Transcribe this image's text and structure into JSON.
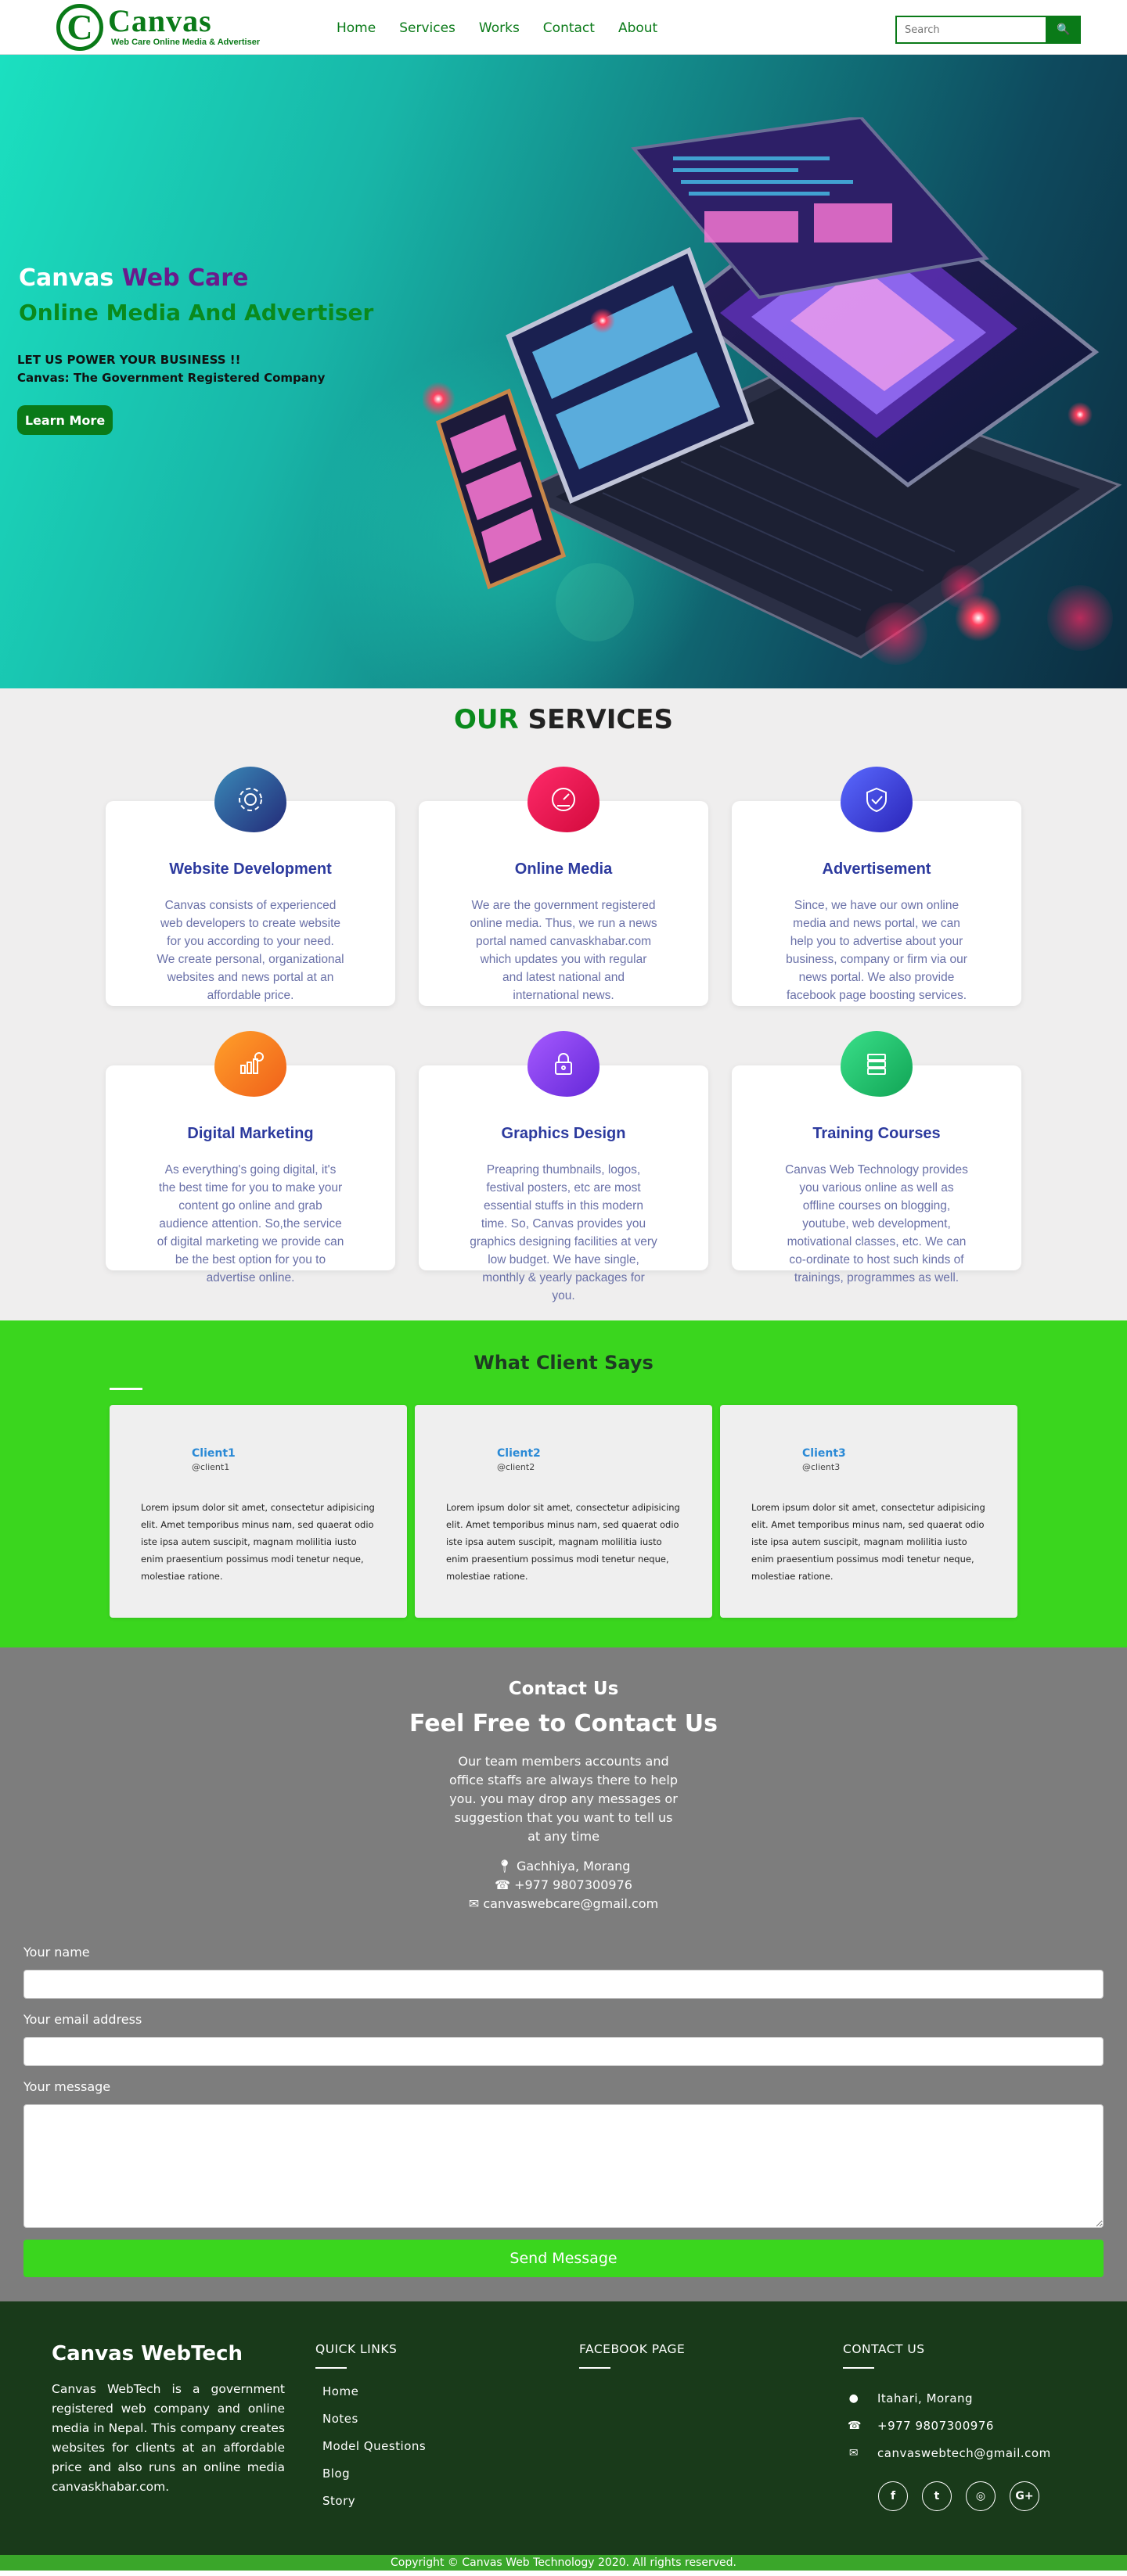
{
  "nav": {
    "logo_brand": "Canvas",
    "logo_letter": "C",
    "logo_tagline": "Web Care Online Media & Advertiser",
    "links": [
      "Home",
      "Services",
      "Works",
      "Contact",
      "About"
    ],
    "search_placeholder": "Search",
    "search_button": "🔍"
  },
  "hero": {
    "title_part1": "Canvas",
    "title_part2": "Web Care",
    "subtitle": "Online Media And Advertiser",
    "line1": "LET US POWER YOUR BUSINESS !!",
    "line2": "Canvas: The Government Registered Company",
    "button": "Learn More"
  },
  "services": {
    "heading_part1": "OUR",
    "heading_part2": "SERVICES",
    "items": [
      {
        "title": "Website Development",
        "text": "Canvas consists of experienced web developers to create website for you according to your need. We create personal, organizational websites and news portal at an affordable price.",
        "icon": "gear-icon",
        "color": "#2d4a8a"
      },
      {
        "title": "Online Media",
        "text": "We are the government registered online media. Thus, we run a news portal named canvaskhabar.com which updates you with regular and latest national and international news.",
        "icon": "speedometer-icon",
        "color": "#e8124f"
      },
      {
        "title": "Advertisement",
        "text": "Since, we have our own online media and news portal, we can help you to advertise about your business, company or firm via our news portal. We also provide facebook page boosting services.",
        "icon": "shield-icon",
        "color": "#3a3fd6"
      },
      {
        "title": "Digital Marketing",
        "text": "As everything's going digital, it's the best time for you to make your content go online and grab audience attention. So,the service of digital marketing we provide can be the best option for you to advertise online.",
        "icon": "chart-icon",
        "color": "#f5731d"
      },
      {
        "title": "Graphics Design",
        "text": "Preapring thumbnails, logos, festival posters, etc are most essential stuffs in this modern time. So, Canvas provides you graphics designing facilities at very low budget. We have single, monthly & yearly packages for you.",
        "icon": "lock-icon",
        "color": "#7a3ae0"
      },
      {
        "title": "Training Courses",
        "text": "Canvas Web Technology provides you various online as well as offline courses on blogging, youtube, web development, motivational classes, etc. We can co-ordinate to host such kinds of trainings, programmes as well.",
        "icon": "server-icon",
        "color": "#1fb86a"
      }
    ]
  },
  "testimonials": {
    "heading": "What Client Says",
    "clients": [
      {
        "name": "Client1",
        "handle": "@client1",
        "text": "Lorem ipsum dolor sit amet, consectetur adipisicing elit. Amet temporibus minus nam, sed quaerat odio iste ipsa autem suscipit, magnam molilitia iusto enim praesentium possimus modi tenetur neque, molestiae ratione."
      },
      {
        "name": "Client2",
        "handle": "@client2",
        "text": "Lorem ipsum dolor sit amet, consectetur adipisicing elit. Amet temporibus minus nam, sed quaerat odio iste ipsa autem suscipit, magnam molilitia iusto enim praesentium possimus modi tenetur neque, molestiae ratione."
      },
      {
        "name": "Client3",
        "handle": "@client3",
        "text": "Lorem ipsum dolor sit amet, consectetur adipisicing elit. Amet temporibus minus nam, sed quaerat odio iste ipsa autem suscipit, magnam molilitia iusto enim praesentium possimus modi tenetur neque, molestiae ratione."
      }
    ]
  },
  "contact": {
    "title": "Contact Us",
    "subtitle": "Feel Free to Contact Us",
    "description": "Our team members accounts and office staffs are always there to help you. you may drop any messages or suggestion that you want to tell us at any time",
    "address": "Gachhiya, Morang",
    "phone": "+977 9807300976",
    "email": "canvaswebcare@gmail.com",
    "name_label": "Your name",
    "email_label": "Your email address",
    "message_label": "Your message",
    "send_button": "Send Message"
  },
  "footer": {
    "brand": "Canvas WebTech",
    "about": "Canvas WebTech is a government registered web company and online media in Nepal. This company creates websites for clients at an affordable price and also runs an online media canvaskhabar.com.",
    "quick_links_heading": "QUICK LINKS",
    "quick_links": [
      "Home",
      "Notes",
      "Model Questions",
      "Blog",
      "Story"
    ],
    "facebook_heading": "FACEBOOK PAGE",
    "contact_heading": "CONTACT US",
    "contact_address": "Itahari, Morang",
    "contact_phone": "+977 9807300976",
    "contact_email": "canvaswebtech@gmail.com",
    "social": [
      {
        "icon": "facebook-icon",
        "glyph": "f"
      },
      {
        "icon": "twitter-icon",
        "glyph": "t"
      },
      {
        "icon": "instagram-icon",
        "glyph": "◎"
      },
      {
        "icon": "google-plus-icon",
        "glyph": "G+"
      }
    ],
    "copyright": "Copyright © Canvas Web Technology 2020. All rights reserved."
  },
  "colors": {
    "brand_green": "#0a7a18",
    "testimonial_bg": "#3ad61e",
    "contact_bg": "#7d7d7d",
    "footer_bg": "#193a1a",
    "service_title": "#2c3a9e"
  }
}
